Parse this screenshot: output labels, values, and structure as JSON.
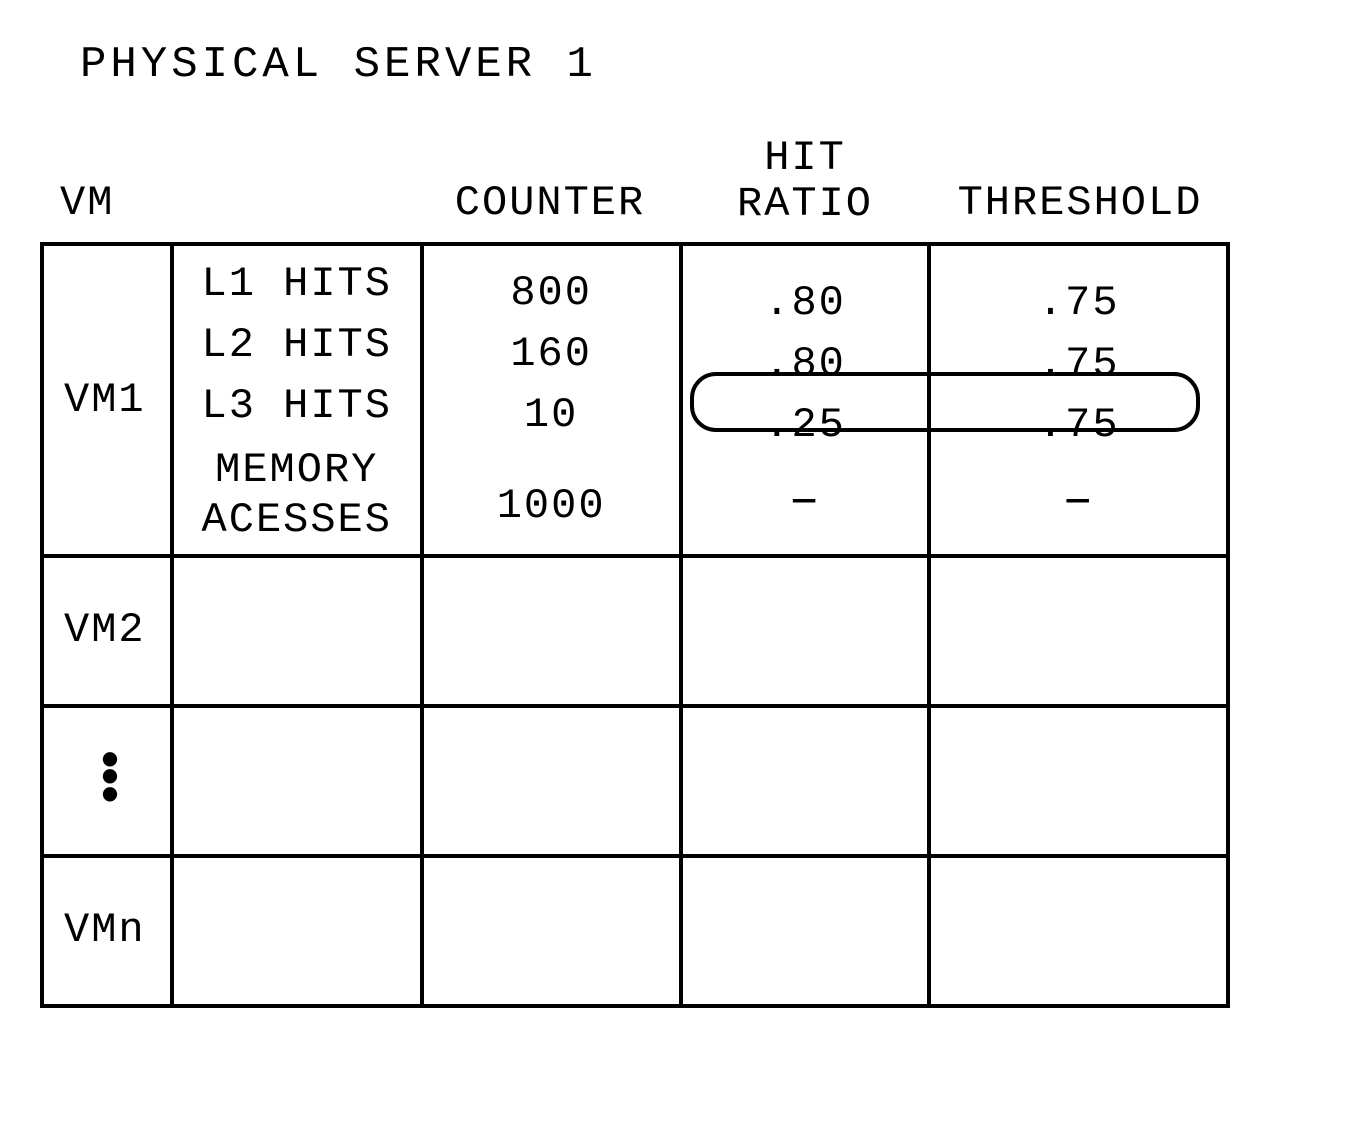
{
  "title": "PHYSICAL SERVER 1",
  "headers": {
    "vm": "VM",
    "counter": "COUNTER",
    "hit_ratio": "HIT\nRATIO",
    "threshold": "THRESHOLD"
  },
  "chart_data": {
    "type": "table",
    "rows": [
      {
        "vm": "VM1",
        "metrics": [
          {
            "name": "L1 HITS",
            "counter": "800",
            "hit_ratio": ".80",
            "threshold": ".75"
          },
          {
            "name": "L2 HITS",
            "counter": "160",
            "hit_ratio": ".80",
            "threshold": ".75"
          },
          {
            "name": "L3 HITS",
            "counter": "10",
            "hit_ratio": ".25",
            "threshold": ".75",
            "highlighted": true
          },
          {
            "name": "MEMORY\nACESSES",
            "counter": "1000",
            "hit_ratio": "–",
            "threshold": "–"
          }
        ]
      },
      {
        "vm": "VM2",
        "metrics": []
      },
      {
        "vm": "⋮",
        "metrics": [],
        "is_ellipsis": true
      },
      {
        "vm": "VMn",
        "metrics": []
      }
    ]
  }
}
